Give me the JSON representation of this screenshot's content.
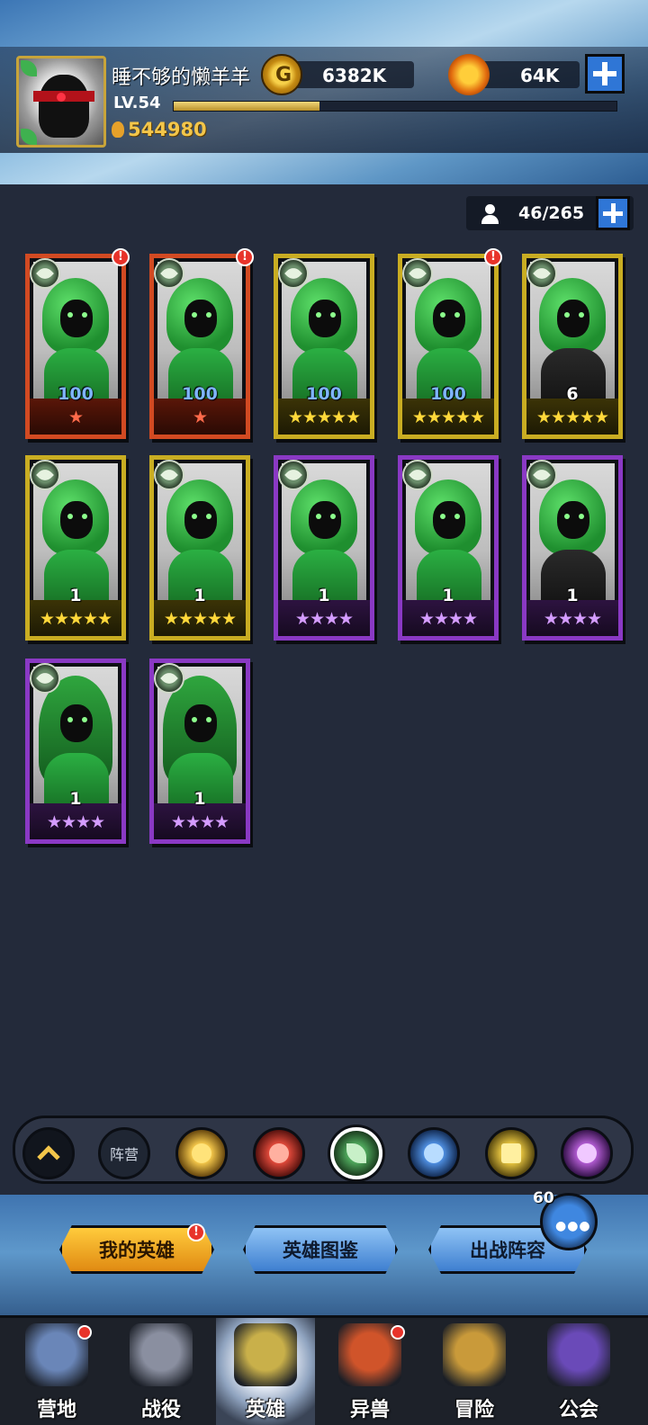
{
  "player": {
    "name": "睡不够的懒羊羊",
    "level": "LV.54",
    "xp_fraction": 0.33,
    "power": "544980"
  },
  "resources": {
    "gold": "6382K",
    "keys": "64K"
  },
  "roster": {
    "count": "46/265"
  },
  "heroes": [
    {
      "level": "100",
      "stars": "★",
      "rarity": "red",
      "alert": "!"
    },
    {
      "level": "100",
      "stars": "★",
      "rarity": "red",
      "alert": "!"
    },
    {
      "level": "100",
      "stars": "★★★★★",
      "rarity": "gold",
      "alert": ""
    },
    {
      "level": "100",
      "stars": "★★★★★",
      "rarity": "gold",
      "alert": "!"
    },
    {
      "level": "6",
      "stars": "★★★★★",
      "rarity": "gold",
      "alert": ""
    },
    {
      "level": "1",
      "stars": "★★★★★",
      "rarity": "gold",
      "alert": ""
    },
    {
      "level": "1",
      "stars": "★★★★★",
      "rarity": "gold",
      "alert": ""
    },
    {
      "level": "1",
      "stars": "★★★★",
      "rarity": "purple",
      "alert": ""
    },
    {
      "level": "1",
      "stars": "★★★★",
      "rarity": "purple",
      "alert": ""
    },
    {
      "level": "1",
      "stars": "★★★★",
      "rarity": "purple",
      "alert": ""
    },
    {
      "level": "1",
      "stars": "★★★★",
      "rarity": "purple",
      "alert": ""
    },
    {
      "level": "1",
      "stars": "★★★★",
      "rarity": "purple",
      "alert": ""
    }
  ],
  "filters": {
    "formation_label": "阵营",
    "factions": [
      "all-icon",
      "light-icon",
      "fire-icon",
      "nature-icon",
      "water-icon",
      "holy-icon",
      "shadow-icon"
    ],
    "selected": "nature-icon"
  },
  "actions": {
    "my_heroes": "我的英雄",
    "my_heroes_alert": "!",
    "hero_codex": "英雄图鉴",
    "battle_lineup": "出战阵容"
  },
  "chat": {
    "count": "60",
    "dots": "●●●"
  },
  "nav": [
    {
      "label": "营地",
      "icon": "camp-icon",
      "dot": true
    },
    {
      "label": "战役",
      "icon": "battle-icon",
      "dot": false
    },
    {
      "label": "英雄",
      "icon": "hero-icon",
      "dot": false
    },
    {
      "label": "异兽",
      "icon": "beast-icon",
      "dot": true
    },
    {
      "label": "冒险",
      "icon": "adventure-icon",
      "dot": false
    },
    {
      "label": "公会",
      "icon": "guild-icon",
      "dot": false
    }
  ],
  "colors": {
    "background": "#232a3a",
    "red_rarity": "#d24a22",
    "gold_rarity": "#c9ad22",
    "purple_rarity": "#8a39c4",
    "accent_gold": "#f3c64a"
  }
}
